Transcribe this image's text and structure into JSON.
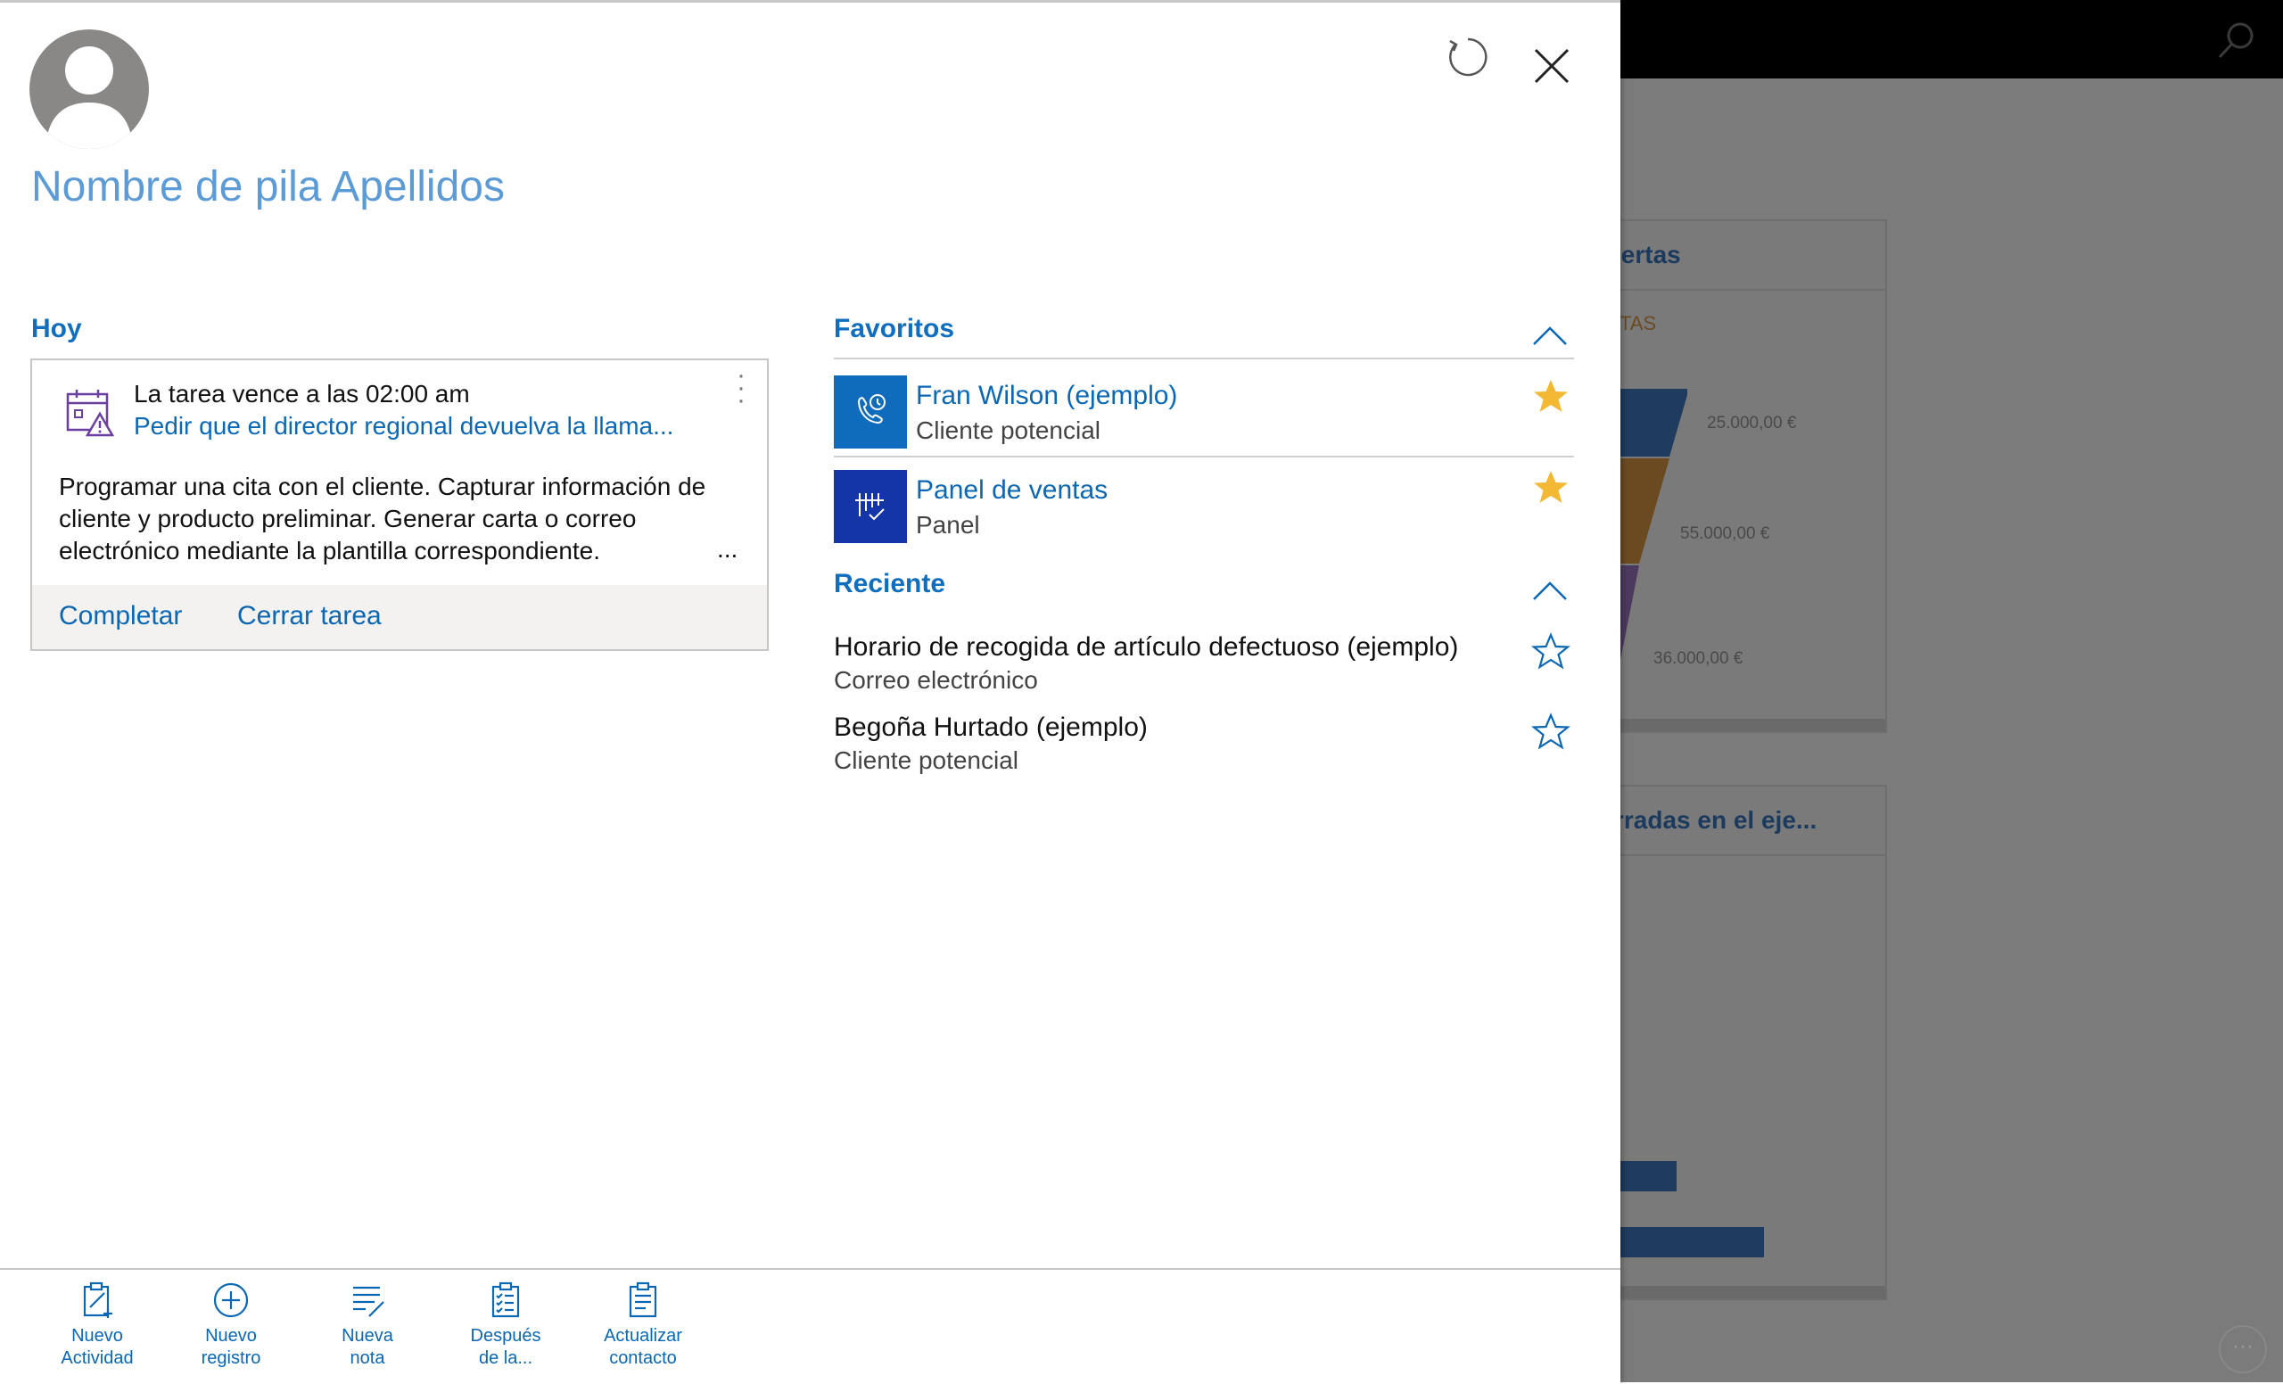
{
  "background": {
    "card1_title": "iertas",
    "card1_subtitle": "TAS",
    "funnel_labels": [
      "25.000,00 €",
      "55.000,00 €",
      "36.000,00 €"
    ],
    "card2_title": "rradas en el eje..."
  },
  "panel": {
    "contact_name": "Nombre de pila Apellidos",
    "today": {
      "title": "Hoy",
      "task": {
        "due": "La tarea vence a las 02:00 am",
        "subject": "Pedir que el director regional devuelva la llama...",
        "description": "Programar una cita con el cliente. Capturar información de cliente y producto preliminar. Generar carta o correo electrónico mediante la plantilla correspondiente.",
        "ellipsis": "...",
        "actions": [
          "Completar",
          "Cerrar tarea"
        ]
      }
    },
    "favorites": {
      "title": "Favoritos",
      "items": [
        {
          "title": "Fran Wilson (ejemplo)",
          "subtitle": "Cliente potencial",
          "tile_color": "#0f6cbd",
          "icon": "phone-contact-icon"
        },
        {
          "title": "Panel de ventas",
          "subtitle": "Panel",
          "tile_color": "#1435a8",
          "icon": "dashboard-icon"
        }
      ]
    },
    "recent": {
      "title": "Reciente",
      "items": [
        {
          "title": "Horario de recogida de artículo defectuoso (ejemplo)",
          "subtitle": "Correo electrónico"
        },
        {
          "title": "Begoña Hurtado (ejemplo)",
          "subtitle": "Cliente potencial"
        }
      ]
    },
    "commands": [
      {
        "line1": "Nuevo",
        "line2": "Actividad",
        "icon": "new-activity-icon"
      },
      {
        "line1": "Nuevo",
        "line2": "registro",
        "icon": "plus-circle-icon"
      },
      {
        "line1": "Nueva",
        "line2": "nota",
        "icon": "note-icon"
      },
      {
        "line1": "Después",
        "line2": "de la...",
        "icon": "checklist-icon"
      },
      {
        "line1": "Actualizar",
        "line2": "contacto",
        "icon": "clipboard-icon"
      }
    ]
  },
  "colors": {
    "accent": "#0a67b4",
    "name": "#5c9bd6",
    "star_filled": "#f3b935",
    "star_outline": "#0a67b4"
  }
}
